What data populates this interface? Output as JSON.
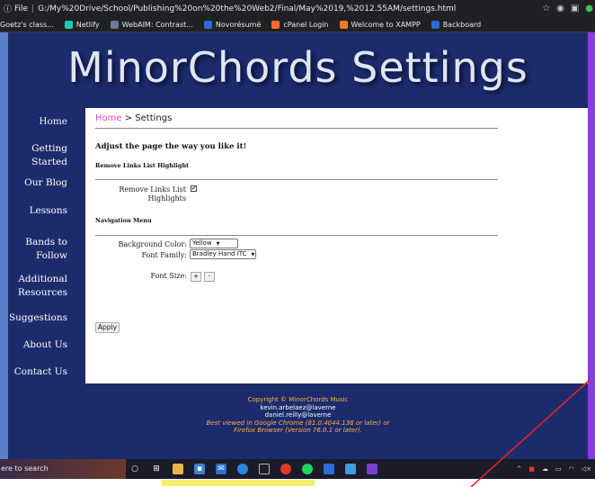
{
  "browser": {
    "info_icon": "info-icon",
    "scheme_label": "File",
    "url": "G:/My%20Drive/School/Publishing%20on%20the%20Web2/Final/May%2019,%2012.55AM/settings.html",
    "bookmarks": [
      {
        "label": "Goetz's class...",
        "color": "#4285f4"
      },
      {
        "label": "Netlify",
        "color": "#20c6b7"
      },
      {
        "label": "WebAIM: Contrast...",
        "color": "#6f7b8a"
      },
      {
        "label": "Novorésumé",
        "color": "#2b6fd6"
      },
      {
        "label": "cPanel Login",
        "color": "#ff6c2c"
      },
      {
        "label": "Welcome to XAMPP",
        "color": "#fb7a24"
      },
      {
        "label": "Backboard",
        "color": "#2a6bd1"
      }
    ]
  },
  "site": {
    "title": "MinorChords Settings",
    "nav": [
      {
        "label": "Home"
      },
      {
        "label": "Getting Started"
      },
      {
        "label": "Our Blog"
      },
      {
        "label": "Lessons"
      },
      {
        "label": "Bands to Follow"
      },
      {
        "label": "Additional Resources"
      },
      {
        "label": "Suggestions"
      },
      {
        "label": "About Us"
      },
      {
        "label": "Contact Us"
      }
    ],
    "breadcrumb": {
      "home": "Home",
      "separator": ">",
      "current": "Settings"
    },
    "main_heading": "Adjust the page the way you like it!",
    "section_links": "Remove Links List Highlight",
    "remove_highlights_label": "Remove Links List Highlights",
    "remove_highlights_checked": true,
    "section_nav": "Navigation Menu",
    "background_color_label": "Background Color:",
    "background_color_value": "Yellow",
    "font_family_label": "Font Family:",
    "font_family_value": "Bradley Hand ITC",
    "font_size_label": "Font Size:",
    "font_size_increase": "+",
    "font_size_decrease": "-",
    "apply_label": "Apply"
  },
  "footer": {
    "copyright": "Copyright © MinorChords Music",
    "email1": "kevin.arbelaez@laverne",
    "email2": "daniel.reilly@laverne",
    "best_viewed": "Best viewed in Google Chrome (81.0.4044.138 or later) or",
    "firefox": "Firefox Browser (Version 76.0.1 or later)."
  },
  "taskbar": {
    "search_text": "ere to search"
  }
}
